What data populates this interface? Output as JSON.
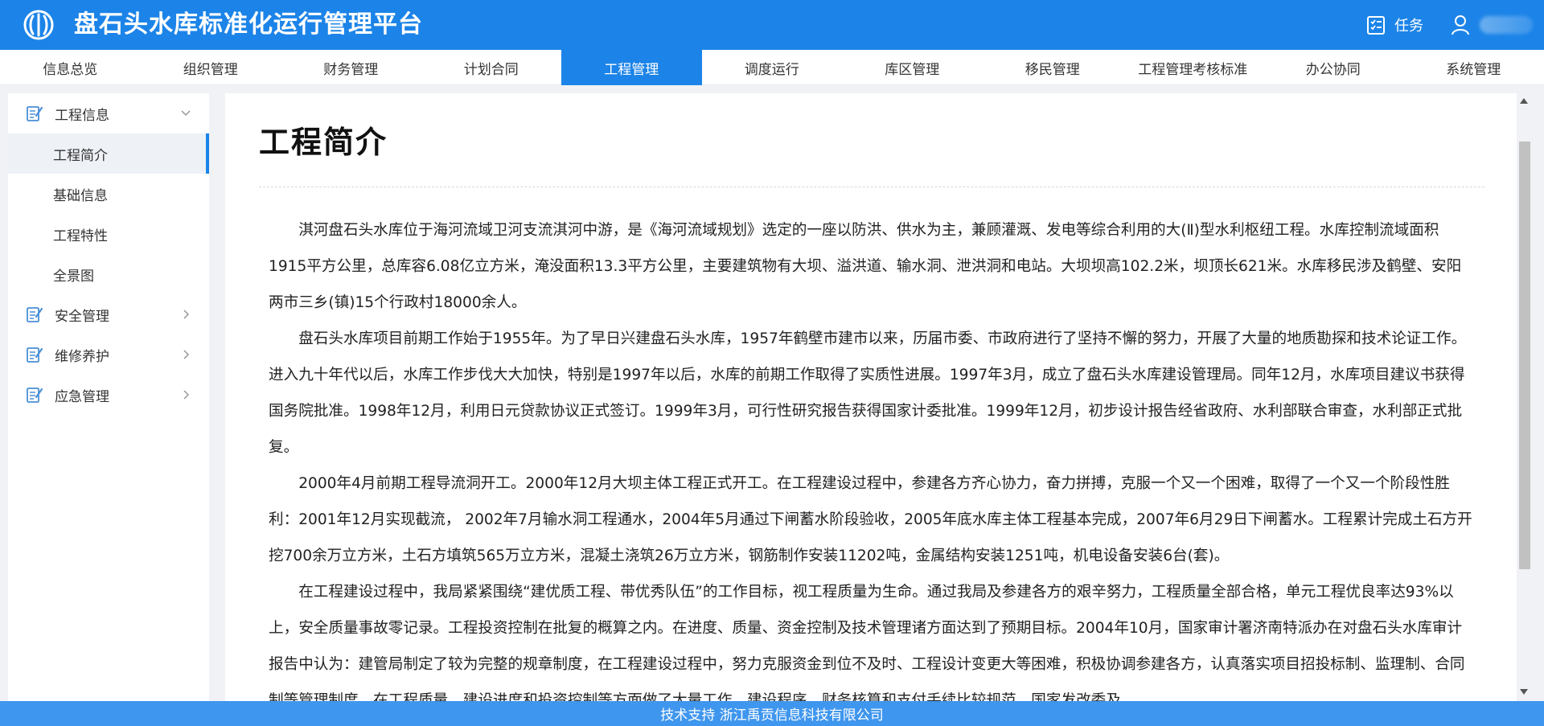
{
  "app": {
    "title": "盘石头水库标准化运行管理平台"
  },
  "header": {
    "task_label": "任务"
  },
  "nav": {
    "items": [
      "信息总览",
      "组织管理",
      "财务管理",
      "计划合同",
      "工程管理",
      "调度运行",
      "库区管理",
      "移民管理",
      "工程管理考核标准",
      "办公协同",
      "系统管理"
    ],
    "active": "工程管理"
  },
  "sidebar": {
    "groups": [
      {
        "label": "工程信息",
        "expanded": true,
        "items": [
          "工程简介",
          "基础信息",
          "工程特性",
          "全景图"
        ],
        "active_item": "工程简介"
      },
      {
        "label": "安全管理",
        "expanded": false
      },
      {
        "label": "维修养护",
        "expanded": false
      },
      {
        "label": "应急管理",
        "expanded": false
      }
    ]
  },
  "main": {
    "title": "工程简介",
    "paragraphs": [
      "淇河盘石头水库位于海河流域卫河支流淇河中游，是《海河流域规划》选定的一座以防洪、供水为主，兼顾灌溉、发电等综合利用的大(Ⅱ)型水利枢纽工程。水库控制流域面积1915平方公里，总库容6.08亿立方米，淹没面积13.3平方公里，主要建筑物有大坝、溢洪道、输水洞、泄洪洞和电站。大坝坝高102.2米，坝顶长621米。水库移民涉及鹤壁、安阳两市三乡(镇)15个行政村18000余人。",
      "盘石头水库项目前期工作始于1955年。为了早日兴建盘石头水库，1957年鹤壁市建市以来，历届市委、市政府进行了坚持不懈的努力，开展了大量的地质勘探和技术论证工作。进入九十年代以后，水库工作步伐大大加快，特别是1997年以后，水库的前期工作取得了实质性进展。1997年3月，成立了盘石头水库建设管理局。同年12月，水库项目建议书获得国务院批准。1998年12月，利用日元贷款协议正式签订。1999年3月，可行性研究报告获得国家计委批准。1999年12月，初步设计报告经省政府、水利部联合审查，水利部正式批复。",
      "2000年4月前期工程导流洞开工。2000年12月大坝主体工程正式开工。在工程建设过程中，参建各方齐心协力，奋力拼搏，克服一个又一个困难，取得了一个又一个阶段性胜利：2001年12月实现截流， 2002年7月输水洞工程通水，2004年5月通过下闸蓄水阶段验收，2005年底水库主体工程基本完成，2007年6月29日下闸蓄水。工程累计完成土石方开挖700余万立方米，土石方填筑565万立方米，混凝土浇筑26万立方米，钢筋制作安装11202吨，金属结构安装1251吨，机电设备安装6台(套)。",
      "在工程建设过程中，我局紧紧围绕“建优质工程、带优秀队伍”的工作目标，视工程质量为生命。通过我局及参建各方的艰辛努力，工程质量全部合格，单元工程优良率达93%以上，安全质量事故零记录。工程投资控制在批复的概算之内。在进度、质量、资金控制及技术管理诸方面达到了预期目标。2004年10月，国家审计署济南特派办在对盘石头水库审计报告中认为：建管局制定了较为完整的规章制度，在工程建设过程中，努力克服资金到位不及时、工程设计变更大等困难，积极协调参建各方，认真落实项目招投标制、监理制、合同制等管理制度，在工程质量、建设进度和投资控制等方面做了大量工作，建设程序、财务核算和支付手续比较规范。国家发改委及"
    ]
  },
  "footer": {
    "text": "技术支持 浙江禹贡信息科技有限公司"
  },
  "colors": {
    "primary": "#1c84e8",
    "footer": "#3f96ee",
    "sidebar_active_bg": "#eef1f6"
  },
  "icons": {
    "logo": "water-ring-logo",
    "task": "task-list-icon",
    "user": "user-icon",
    "group": "edit-document-icon"
  }
}
